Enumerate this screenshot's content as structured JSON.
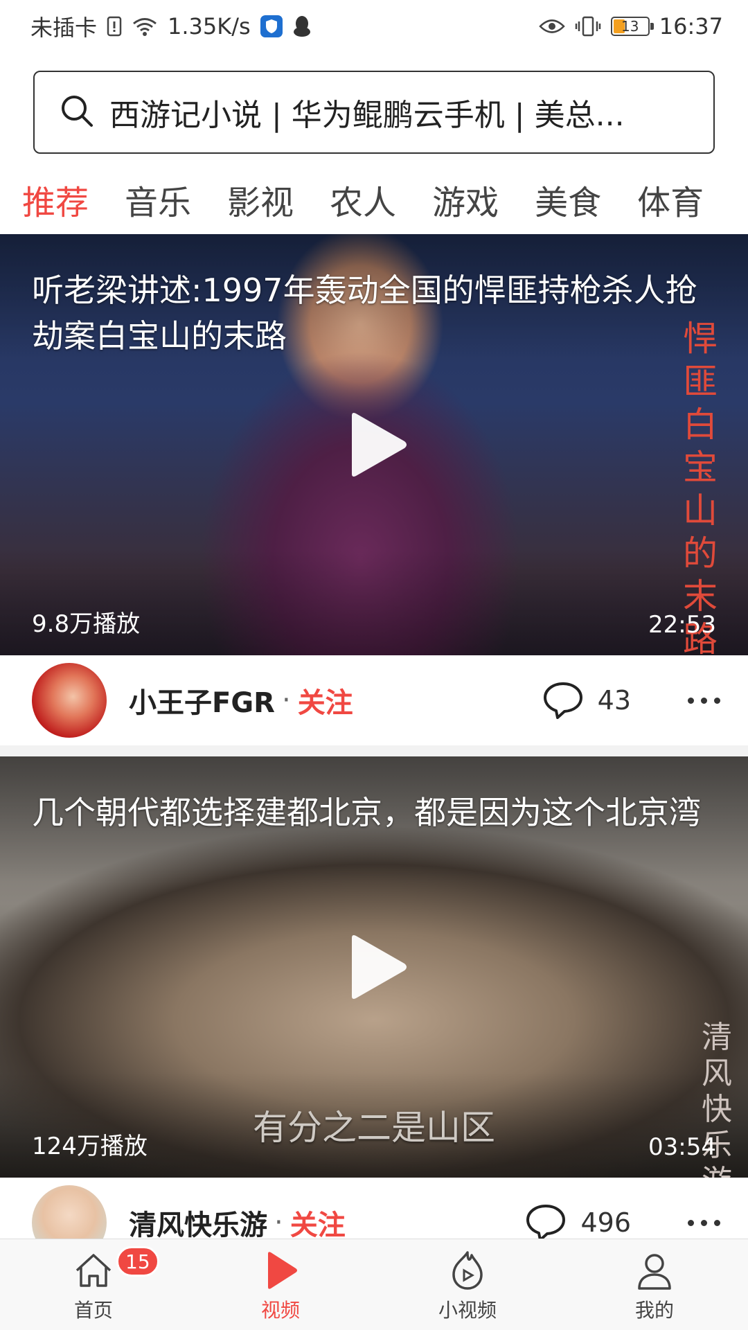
{
  "status_bar": {
    "carrier": "未插卡",
    "net_speed": "1.35K/s",
    "battery": "13",
    "time": "16:37"
  },
  "search": {
    "text": "西游记小说 | 华为鲲鹏云手机 | 美总..."
  },
  "tabs": [
    {
      "label": "推荐",
      "active": true
    },
    {
      "label": "音乐"
    },
    {
      "label": "影视"
    },
    {
      "label": "农人"
    },
    {
      "label": "游戏"
    },
    {
      "label": "美食"
    },
    {
      "label": "体育"
    }
  ],
  "videos": [
    {
      "title": "听老梁讲述:1997年轰动全国的悍匪持枪杀人抢劫案白宝山的末路",
      "views": "9.8万播放",
      "duration": "22:53",
      "side_caption": "悍匪白宝山的末路",
      "author": "小王子FGR",
      "follow": "关注",
      "comments": "43"
    },
    {
      "title": "几个朝代都选择建都北京，都是因为这个北京湾",
      "views": "124万播放",
      "duration": "03:54",
      "subtitle": "有分之二是山区",
      "side_caption": "清风快乐游",
      "author": "清风快乐游",
      "follow": "关注",
      "comments": "496"
    }
  ],
  "bottom_nav": [
    {
      "label": "首页",
      "icon": "home-icon",
      "badge": "15"
    },
    {
      "label": "视频",
      "icon": "play-icon",
      "active": true
    },
    {
      "label": "小视频",
      "icon": "short-video-icon"
    },
    {
      "label": "我的",
      "icon": "profile-icon"
    }
  ],
  "colors": {
    "accent": "#f04842",
    "text": "#222222",
    "nav_bg": "#f8f8f8"
  }
}
